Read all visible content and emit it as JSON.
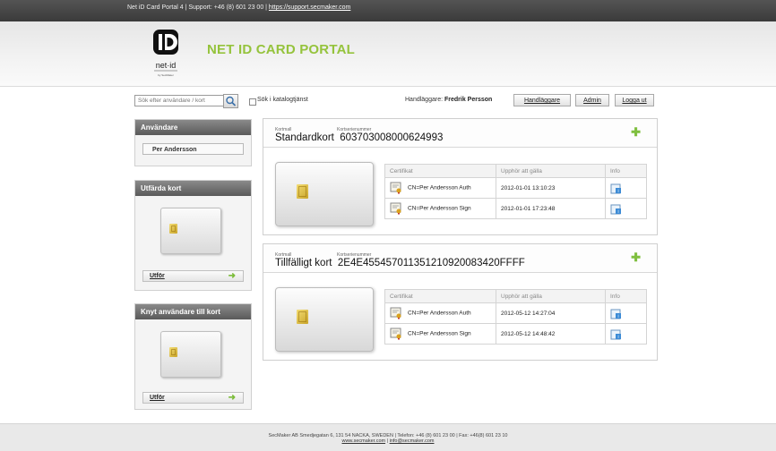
{
  "topbar": {
    "text": "Net iD Card Portal 4 | Support: +46 (8) 601 23 00 | ",
    "link": "https://support.secmaker.com"
  },
  "header": {
    "title": "NET ID CARD PORTAL",
    "logo_text": "net·id",
    "logo_sub": "by SecMaker"
  },
  "search": {
    "placeholder": "Sök efter användare / kort",
    "checkbox_label": "Sök i katalogtjänst"
  },
  "handler": {
    "label": "Handläggare:",
    "name": "Fredrik Persson"
  },
  "nav": {
    "handlaggare": "Handläggare",
    "admin": "Admin",
    "logout": "Logga ut"
  },
  "sidebar": {
    "users_title": "Användare",
    "user_name": "Per Andersson",
    "issue_title": "Utfärda kort",
    "issue_action": "Utför",
    "link_title": "Knyt användare till kort",
    "link_action": "Utför"
  },
  "cards": [
    {
      "template_label": "Kortmall",
      "template": "Standardkort",
      "serial_label": "Kortserienummer",
      "serial": "603703008000624993",
      "headers": {
        "cert": "Certifikat",
        "expires": "Upphör att gälla",
        "info": "Info"
      },
      "certs": [
        {
          "name": "CN=Per Andersson Auth",
          "expires": "2012-01-01 13:10:23"
        },
        {
          "name": "CN=Per Andersson Sign",
          "expires": "2012-01-01 17:23:48"
        }
      ]
    },
    {
      "template_label": "Kortmall",
      "template": "Tillfälligt kort",
      "serial_label": "Kortserienummer",
      "serial": "2E4E455457011351210920083420FFFF",
      "headers": {
        "cert": "Certifikat",
        "expires": "Upphör att gälla",
        "info": "Info"
      },
      "certs": [
        {
          "name": "CN=Per Andersson Auth",
          "expires": "2012-05-12 14:27:04"
        },
        {
          "name": "CN=Per Andersson Sign",
          "expires": "2012-05-12 14:48:42"
        }
      ]
    }
  ],
  "footer": {
    "line1": "SecMaker AB Smedjegatan 6, 131 54 NACKA, SWEDEN | Telefon: +46 (8) 601 23 00 | Fax: +46(8) 601 23 10",
    "link1": "www.secmaker.com",
    "sep": " | ",
    "link2": "info@secmaker.com"
  },
  "colors": {
    "accent_green": "#95c33c",
    "top_bar": "#454545",
    "chip_gold": "#d9b63c"
  }
}
